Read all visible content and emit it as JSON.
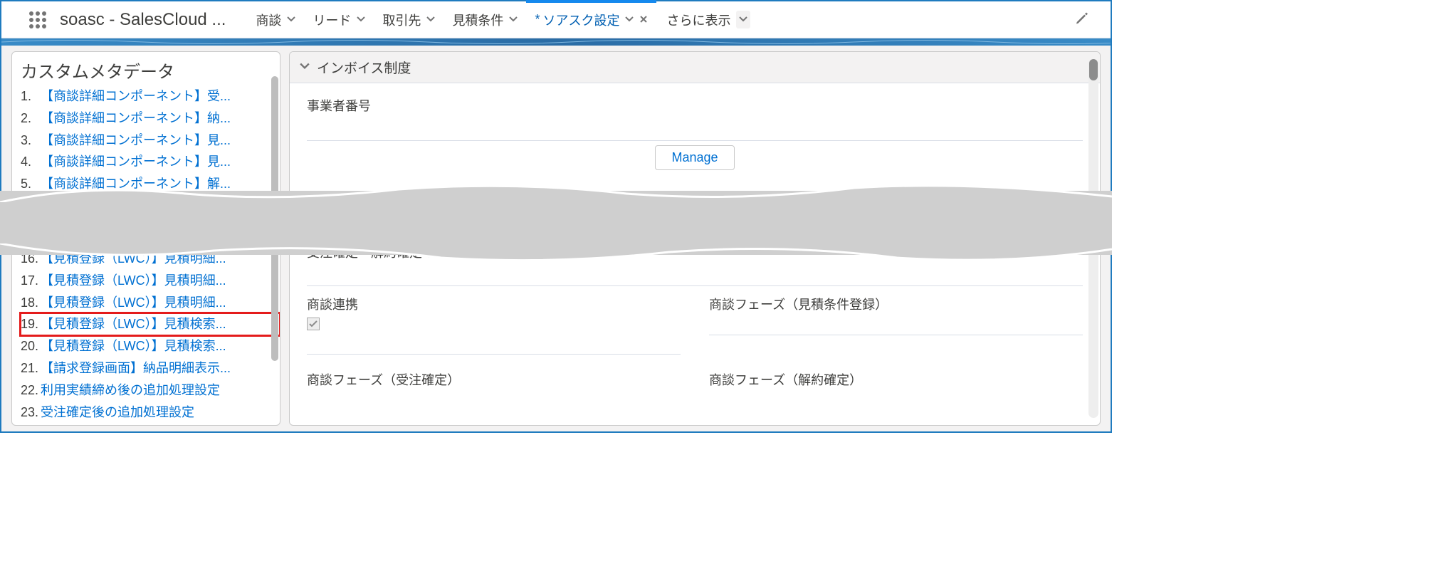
{
  "header": {
    "app_name": "soasc - SalesCloud ...",
    "tabs": [
      {
        "label": "商談"
      },
      {
        "label": "リード"
      },
      {
        "label": "取引先"
      },
      {
        "label": "見積条件"
      }
    ],
    "active_tab": {
      "label": "ソアスク設定",
      "dirty_marker": "*"
    },
    "more_label": "さらに表示"
  },
  "sidebar": {
    "title": "カスタムメタデータ",
    "items_top": [
      {
        "n": "1.",
        "label": "【商談詳細コンポーネント】受..."
      },
      {
        "n": "2.",
        "label": "【商談詳細コンポーネント】納..."
      },
      {
        "n": "3.",
        "label": "【商談詳細コンポーネント】見..."
      },
      {
        "n": "4.",
        "label": "【商談詳細コンポーネント】見..."
      },
      {
        "n": "5.",
        "label": "【商談詳細コンポーネント】解..."
      }
    ],
    "items_bottom": [
      {
        "n": "16.",
        "label": "【見積登録（LWC）】見積明細..."
      },
      {
        "n": "17.",
        "label": "【見積登録（LWC）】見積明細..."
      },
      {
        "n": "18.",
        "label": "【見積登録（LWC）】見積明細..."
      },
      {
        "n": "19.",
        "label": "【見積登録（LWC）】見積検索...",
        "hilite": true
      },
      {
        "n": "20.",
        "label": "【見積登録（LWC）】見積検索..."
      },
      {
        "n": "21.",
        "label": "【請求登録画面】納品明細表示..."
      },
      {
        "n": "22.",
        "label": "利用実績締め後の追加処理設定"
      },
      {
        "n": "23.",
        "label": "受注確定後の追加処理設定"
      }
    ]
  },
  "main": {
    "section_invoice": {
      "title": "インボイス制度",
      "field_business_number": "事業者番号",
      "manage_btn": "Manage"
    },
    "section_opp": {
      "title_partial": "商談連携",
      "perm_label": "受注確定・解約確定の許可条件",
      "fields": {
        "opp_link": "商談連携",
        "opp_link_checked": true,
        "opp_phase_quote": "商談フェーズ（見積条件登録）",
        "opp_phase_order": "商談フェーズ（受注確定）",
        "opp_phase_cancel": "商談フェーズ（解約確定）"
      }
    }
  }
}
